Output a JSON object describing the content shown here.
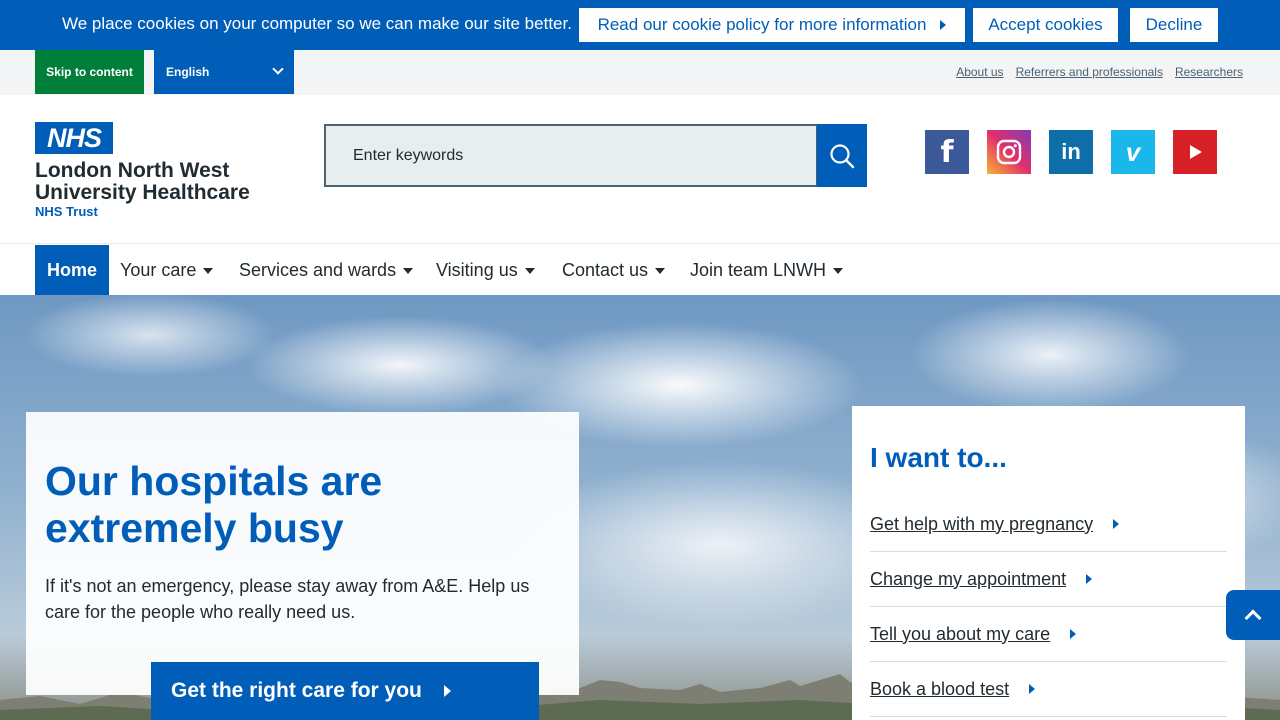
{
  "cookie": {
    "message": "We place cookies on your computer so we can make our site better.",
    "policy_link": "Read our cookie policy for more information",
    "accept": "Accept cookies",
    "decline": "Decline"
  },
  "utility": {
    "skip": "Skip to content",
    "language": "English",
    "links": [
      "About us",
      "Referrers and professionals",
      "Researchers"
    ]
  },
  "header": {
    "logo": "NHS",
    "org_line1": "London North West",
    "org_line2": "University Healthcare",
    "org_line3": "NHS Trust",
    "search_placeholder": "Enter keywords",
    "social": {
      "facebook": "f",
      "linkedin": "in",
      "vimeo": "v"
    }
  },
  "nav": {
    "items": [
      "Home",
      "Your care",
      "Services and wards",
      "Visiting us",
      "Contact us",
      "Join team LNWH"
    ]
  },
  "hero": {
    "title": "Our hospitals are extremely busy",
    "text": "If it's not an emergency, please stay away from A&E. Help us care for the people who really need us.",
    "cta": "Get the right care for you"
  },
  "want": {
    "title": "I want to...",
    "links": [
      "Get help with my pregnancy",
      "Change my appointment",
      "Tell you about my care",
      "Book a blood test"
    ]
  },
  "colors": {
    "nhs_blue": "#005eb8",
    "nhs_green": "#007f3b",
    "text": "#212b32"
  }
}
